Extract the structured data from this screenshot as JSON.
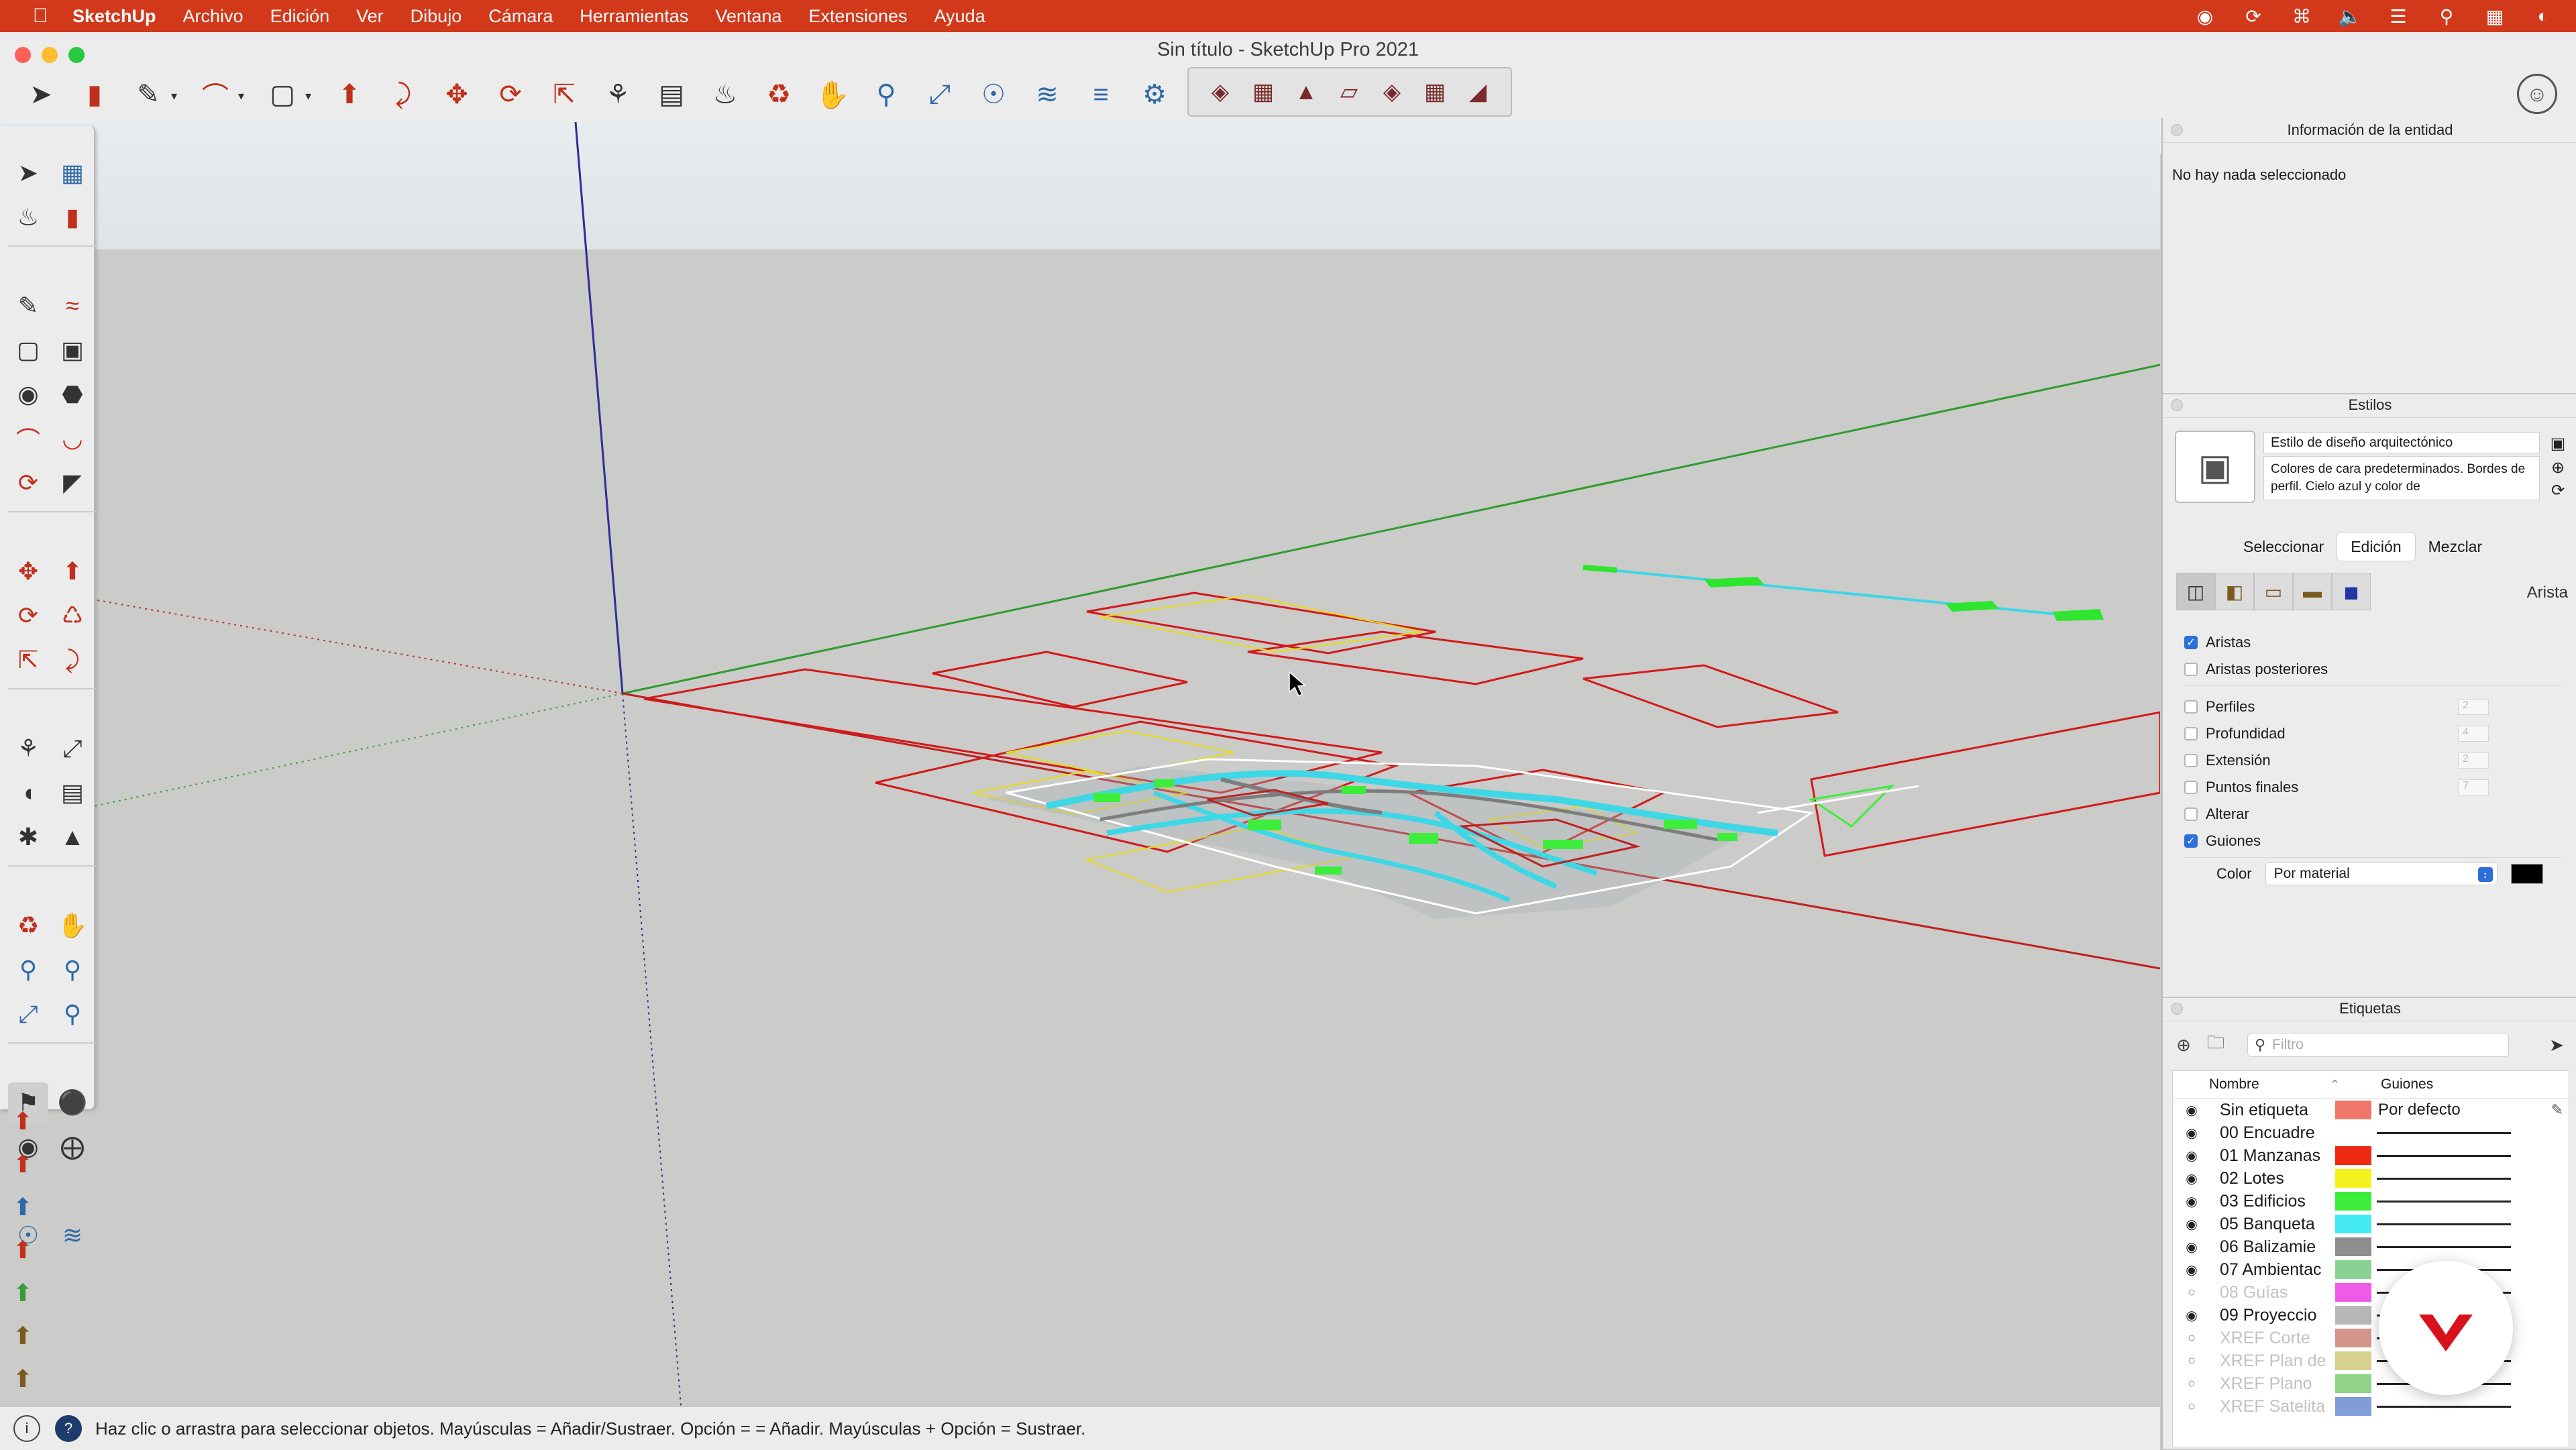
{
  "menubar": {
    "apple_icon": "apple-icon",
    "app_name": "SketchUp",
    "menus": [
      "Archivo",
      "Edición",
      "Ver",
      "Dibujo",
      "Cámara",
      "Herramientas",
      "Ventana",
      "Extensiones",
      "Ayuda"
    ]
  },
  "window": {
    "title": "Sin título - SketchUp Pro 2021"
  },
  "statusbar": {
    "message": "Haz clic o arrastra para seleccionar objetos. Mayúsculas = Añadir/Sustraer. Opción = = Añadir. Mayúsculas + Opción = Sustraer."
  },
  "entity_info": {
    "title": "Información de la entidad",
    "empty_text": "No hay nada seleccionado"
  },
  "styles": {
    "title": "Estilos",
    "style_name": "Estilo de diseño arquitectónico",
    "description": "Colores de cara predeterminados. Bordes de perfil. Cielo azul y color de",
    "tabs": [
      "Seleccionar",
      "Edición",
      "Mezclar"
    ],
    "active_tab": "Edición",
    "category_label": "Arista",
    "options": [
      {
        "label": "Aristas",
        "checked": true,
        "value": ""
      },
      {
        "label": "Aristas posteriores",
        "checked": false,
        "value": ""
      },
      {
        "label": "Perfiles",
        "checked": false,
        "value": "2"
      },
      {
        "label": "Profundidad",
        "checked": false,
        "value": "4"
      },
      {
        "label": "Extensión",
        "checked": false,
        "value": "2"
      },
      {
        "label": "Puntos finales",
        "checked": false,
        "value": "7"
      },
      {
        "label": "Alterar",
        "checked": false,
        "value": ""
      },
      {
        "label": "Guiones",
        "checked": true,
        "value": ""
      }
    ],
    "color_label": "Color",
    "color_value": "Por material",
    "color_swatch": "#000000"
  },
  "tags": {
    "title": "Etiquetas",
    "search_placeholder": "Filtro",
    "col_name": "Nombre",
    "col_dashes": "Guiones",
    "rows": [
      {
        "name": "Sin etiqueta",
        "visible": true,
        "color": "#f0776b",
        "dash": "Por defecto"
      },
      {
        "name": "00 Encuadre",
        "visible": true,
        "color": "#ffffff",
        "dash": ""
      },
      {
        "name": "01 Manzanas",
        "visible": true,
        "color": "#ee2a14",
        "dash": ""
      },
      {
        "name": "02 Lotes",
        "visible": true,
        "color": "#f4f21e",
        "dash": ""
      },
      {
        "name": "03 Edificios",
        "visible": true,
        "color": "#3ded3b",
        "dash": ""
      },
      {
        "name": "05 Banqueta",
        "visible": true,
        "color": "#43eaf0",
        "dash": ""
      },
      {
        "name": "06 Balizamie",
        "visible": true,
        "color": "#8e8e8e",
        "dash": ""
      },
      {
        "name": "07 Ambientac",
        "visible": true,
        "color": "#88d391",
        "dash": ""
      },
      {
        "name": "08 Guías",
        "visible": false,
        "color": "#f05ae8",
        "dash": ""
      },
      {
        "name": "09 Proyeccio",
        "visible": true,
        "color": "#b7b7b7",
        "dash": ""
      },
      {
        "name": "XREF Corte",
        "visible": false,
        "color": "#d3968a",
        "dash": ""
      },
      {
        "name": "XREF Plan de",
        "visible": false,
        "color": "#d8d28e",
        "dash": ""
      },
      {
        "name": "XREF Plano",
        "visible": false,
        "color": "#92d38a",
        "dash": ""
      },
      {
        "name": "XREF Satelita",
        "visible": false,
        "color": "#7f9ed8",
        "dash": ""
      }
    ]
  }
}
